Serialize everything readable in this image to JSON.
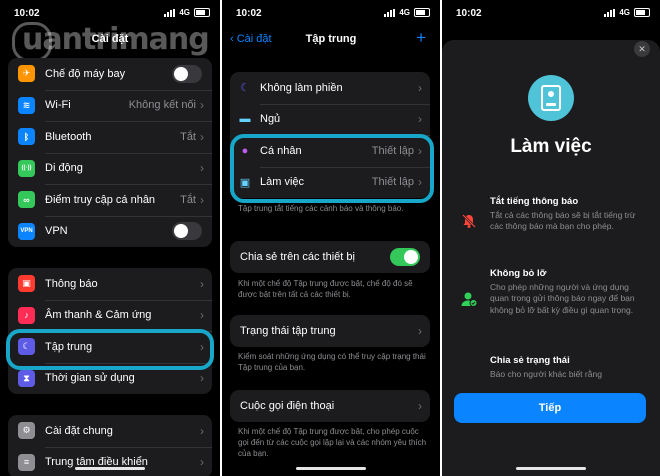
{
  "status": {
    "time": "10:02",
    "network": "4G"
  },
  "watermark": "uantrimang",
  "panel1": {
    "title": "Cài đặt",
    "group1": [
      {
        "label": "Chế độ máy bay",
        "icon": "airplane-icon",
        "color": "#ff9500",
        "glyph": "✈",
        "toggle": false
      },
      {
        "label": "Wi-Fi",
        "icon": "wifi-icon",
        "color": "#0a84ff",
        "glyph": "≋",
        "value": "Không kết nối"
      },
      {
        "label": "Bluetooth",
        "icon": "bluetooth-icon",
        "color": "#0a84ff",
        "glyph": "ᛒ",
        "value": "Tắt"
      },
      {
        "label": "Di động",
        "icon": "cellular-icon",
        "color": "#34c759",
        "glyph": "((·))"
      },
      {
        "label": "Điểm truy cập cá nhân",
        "icon": "hotspot-icon",
        "color": "#34c759",
        "glyph": "∞",
        "value": "Tắt"
      },
      {
        "label": "VPN",
        "icon": "vpn-icon",
        "color": "#0a84ff",
        "glyph": "VPN",
        "toggle": false
      }
    ],
    "group2": [
      {
        "label": "Thông báo",
        "icon": "notifications-icon",
        "color": "#ff3b30",
        "glyph": "▣"
      },
      {
        "label": "Âm thanh & Cảm ứng",
        "icon": "sound-icon",
        "color": "#ff2d55",
        "glyph": "♪"
      },
      {
        "label": "Tập trung",
        "icon": "focus-moon-icon",
        "color": "#5e5ce6",
        "glyph": "☾"
      },
      {
        "label": "Thời gian sử dụng",
        "icon": "screen-time-icon",
        "color": "#5e5ce6",
        "glyph": "⧗"
      }
    ],
    "group3": [
      {
        "label": "Cài đặt chung",
        "icon": "general-gear-icon",
        "color": "#8e8e93",
        "glyph": "⚙"
      },
      {
        "label": "Trung tâm điều khiển",
        "icon": "control-center-icon",
        "color": "#8e8e93",
        "glyph": "≡"
      }
    ]
  },
  "panel2": {
    "back": "Cài đặt",
    "title": "Tập trung",
    "modes": [
      {
        "label": "Không làm phiền",
        "icon": "moon-icon",
        "color": "#5e5ce6",
        "glyph": "☾"
      },
      {
        "label": "Ngủ",
        "icon": "bed-icon",
        "color": "#64d2ff",
        "glyph": "▬"
      },
      {
        "label": "Cá nhân",
        "icon": "person-icon",
        "color": "#bf5af2",
        "glyph": "●",
        "value": "Thiết lập"
      },
      {
        "label": "Làm việc",
        "icon": "badge-icon",
        "color": "#64d2ff",
        "glyph": "▣",
        "value": "Thiết lập"
      }
    ],
    "modes_note": "Tập trung tắt tiếng các cảnh báo và thông báo.",
    "share_label": "Chia sẻ trên các thiết bị",
    "share_on": true,
    "share_note": "Khi một chế độ Tập trung được bật, chế độ đó sẽ được bật trên tất cả các thiết bị.",
    "status_label": "Trạng thái tập trung",
    "status_note": "Kiểm soát những ứng dụng có thể truy cập trạng thái Tập trung của bạn.",
    "calls_label": "Cuộc gọi điện thoại",
    "calls_note": "Khi một chế độ Tập trung được bật, cho phép cuộc gọi đến từ các cuộc gọi lặp lại và các nhóm yêu thích của bạn."
  },
  "panel3": {
    "title": "Làm việc",
    "features": [
      {
        "heading": "Tắt tiếng thông báo",
        "body": "Tắt cả các thông báo sẽ bị tắt tiếng trừ các thông báo mà bạn cho phép.",
        "icon": "bell-slash-icon"
      },
      {
        "heading": "Không bỏ lỡ",
        "body": "Cho phép những người và ứng dụng quan trọng gửi thông báo ngay để bạn không bỏ lỡ bất kỳ điều gì quan trọng.",
        "icon": "person-check-icon"
      },
      {
        "heading": "Chia sẻ trạng thái",
        "body": "Báo cho người khác biết rằng",
        "icon": "share-status-icon"
      }
    ],
    "next_button": "Tiếp"
  }
}
